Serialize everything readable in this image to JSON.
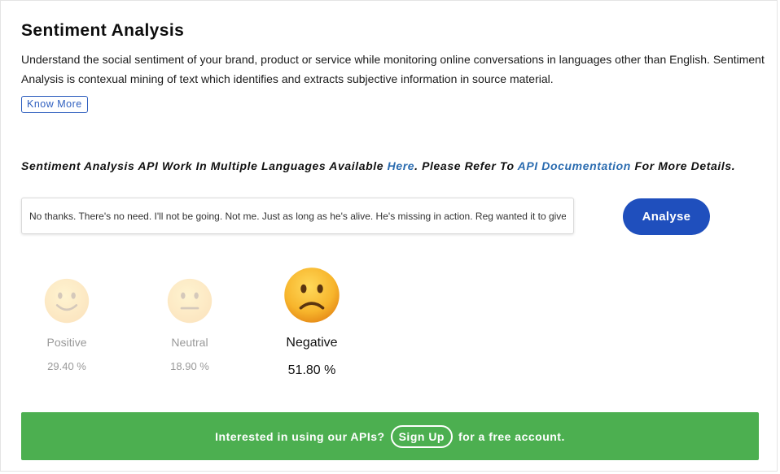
{
  "header": {
    "title": "Sentiment Analysis",
    "description": "Understand the social sentiment of your brand, product or service while monitoring online conversations in languages other than English. Sentiment Analysis is contexual mining of text which identifies and extracts subjective information in source material.",
    "know_more_label": "Know More"
  },
  "api_note": {
    "prefix": "Sentiment Analysis API Work In Multiple Languages Available ",
    "here_link": "Here",
    "middle": ". Please Refer To ",
    "doc_link": "API Documentation",
    "suffix": " For More Details."
  },
  "analyzer": {
    "input_value": "No thanks. There's no need. I'll not be going. Not me. Just as long as he's alive. He's missing in action. Reg wanted it to give",
    "button_label": "Analyse"
  },
  "results": {
    "positive": {
      "label": "Positive",
      "percent": "29.40 %",
      "icon": "smiling-face-icon",
      "active": false
    },
    "neutral": {
      "label": "Neutral",
      "percent": "18.90 %",
      "icon": "neutral-face-icon",
      "active": false
    },
    "negative": {
      "label": "Negative",
      "percent": "51.80 %",
      "icon": "frowning-face-icon",
      "active": true
    }
  },
  "signup": {
    "prefix": "Interested in using our APIs?",
    "button_label": "Sign Up",
    "suffix": "for a free account."
  },
  "colors": {
    "accent_blue": "#1f4fbd",
    "link_blue": "#2b6cb0",
    "signup_green": "#4caf50",
    "emoji_yellow": "#f7b52c"
  }
}
